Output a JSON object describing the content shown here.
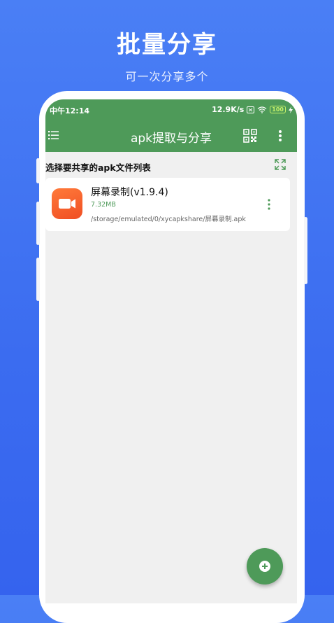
{
  "promo": {
    "title": "批量分享",
    "subtitle": "可一次分享多个"
  },
  "status_bar": {
    "time": "中午12:14",
    "speed": "12.9K/s",
    "battery": "100"
  },
  "toolbar": {
    "title": "apk提取与分享",
    "menu_icon": "hamburger-list-icon",
    "qr_icon": "qr-code-icon",
    "more_icon": "more-vertical-icon"
  },
  "section": {
    "label": "选择要共享的apk文件列表",
    "expand_icon": "expand-icon"
  },
  "apk_list": [
    {
      "name": "屏幕录制(v1.9.4)",
      "size": "7.32MB",
      "path": "/storage/emulated/0/xycapkshare/屏幕录制.apk",
      "icon": "video-camera-icon"
    }
  ],
  "fab": {
    "icon": "add-circle-icon"
  },
  "colors": {
    "background": "#3b6cf0",
    "appbar": "#4e9a59",
    "app_icon": "#f04e23"
  }
}
